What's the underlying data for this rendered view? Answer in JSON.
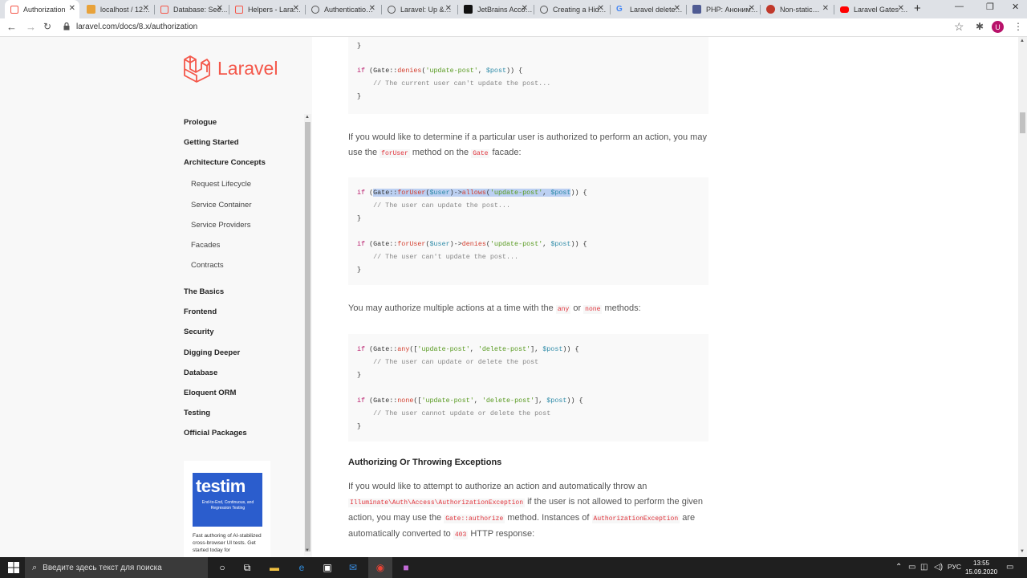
{
  "browser": {
    "tabs": [
      {
        "label": "Authorization",
        "icon": "laravel-icon",
        "active": true
      },
      {
        "label": "localhost / 12…",
        "icon": "phpmyadmin-icon"
      },
      {
        "label": "Database: See…",
        "icon": "laravel-icon"
      },
      {
        "label": "Helpers - Lara…",
        "icon": "laravel-icon"
      },
      {
        "label": "Authenticatio…",
        "icon": "globe-icon"
      },
      {
        "label": "Laravel: Up &…",
        "icon": "globe-icon"
      },
      {
        "label": "JetBrains Acco…",
        "icon": "jetbrains-icon"
      },
      {
        "label": "Creating a Hid…",
        "icon": "globe-icon"
      },
      {
        "label": "Laravel delete…",
        "icon": "google-icon"
      },
      {
        "label": "PHP: Аноним…",
        "icon": "php-icon"
      },
      {
        "label": "Non-static…",
        "icon": "pen-icon"
      },
      {
        "label": "Laravel Gates …",
        "icon": "youtube-icon"
      }
    ],
    "url": "laravel.com/docs/8.x/authorization",
    "avatar_letter": "U"
  },
  "sidebar": {
    "logo_text": "Laravel",
    "top_items": [
      "Prologue",
      "Getting Started",
      "Architecture Concepts"
    ],
    "sub_items": [
      "Request Lifecycle",
      "Service Container",
      "Service Providers",
      "Facades",
      "Contracts"
    ],
    "bottom_items": [
      "The Basics",
      "Frontend",
      "Security",
      "Digging Deeper",
      "Database",
      "Eloquent ORM",
      "Testing",
      "Official Packages"
    ],
    "ad": {
      "logo": "testim",
      "tagline": "End-to-End, Continuous, and Regression Testing",
      "text": "Fast authoring of AI-stabilized cross-browser UI tests. Get started today for"
    }
  },
  "content": {
    "code1": {
      "line1": "if (Gate::denies('update-post', $post)) {",
      "line2": "    // The current user can't update the post..."
    },
    "para1": {
      "a": "If you would like to determine if a particular user is authorized to perform an action, you may use the",
      "code_a": "forUser",
      "b": "method on the",
      "code_b": "Gate",
      "c": "facade:"
    },
    "code2": {
      "comment1": "// The user can update the post...",
      "comment2": "// The user can't update the post..."
    },
    "para2": {
      "a": "You may authorize multiple actions at a time with the",
      "code_a": "any",
      "b": "or",
      "code_b": "none",
      "c": "methods:"
    },
    "code3": {
      "comment1": "// The user can update or delete the post",
      "comment2": "// The user cannot update or delete the post"
    },
    "heading": "Authorizing Or Throwing Exceptions",
    "para3": {
      "a": "If you would like to attempt to authorize an action and automatically throw an",
      "code_a": "Illuminate\\Auth\\Access\\AuthorizationException",
      "b": "if the user is not allowed to perform the given action, you may use the",
      "code_b": "Gate::authorize",
      "c": "method. Instances of",
      "code_c": "AuthorizationException",
      "d": "are automatically converted to",
      "code_d": "403",
      "e": "HTTP response:"
    }
  },
  "taskbar": {
    "search_placeholder": "Введите здесь текст для поиска",
    "lang": "РУС",
    "time": "13:55",
    "date": "15.09.2020"
  },
  "colors": {
    "laravel_red": "#f4574a",
    "tab_strip": "#dee1e6",
    "taskbar": "#1f1f1f"
  }
}
